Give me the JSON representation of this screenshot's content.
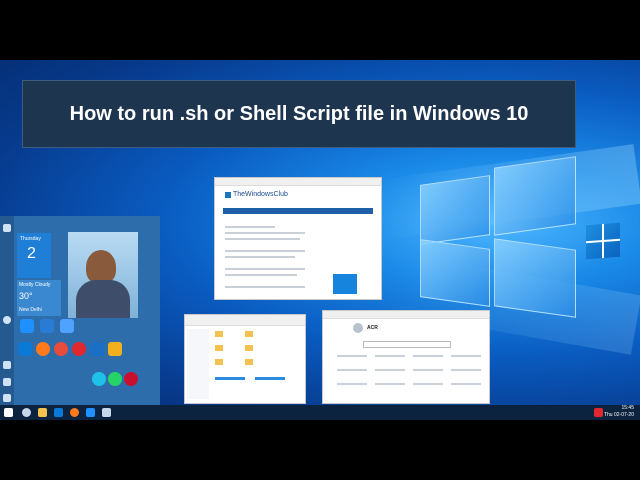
{
  "banner": {
    "title": "How to run .sh or Shell Script file in Windows 10"
  },
  "start_menu": {
    "calendar_day": "Thursday",
    "calendar_date": "2",
    "weather_condition": "Mostly Cloudy",
    "weather_temp": "30°",
    "weather_city": "New Delhi"
  },
  "browser_window": {
    "site_name": "TheWindowsClub"
  },
  "settings_window": {
    "user_initials": "ACR"
  },
  "taskbar": {
    "time": "15:45",
    "date": "Thu 02-07-20"
  },
  "icons": [
    "start-icon",
    "search-icon",
    "edge-icon",
    "file-explorer-icon",
    "settings-icon",
    "firefox-icon",
    "store-icon",
    "windows-logo-icon"
  ],
  "colors": {
    "screen_blue": "#0a5bc0",
    "banner_bg": "#1e3550",
    "start_menu_bg": "#2d6dab",
    "taskbar_bg": "#0c2340"
  }
}
